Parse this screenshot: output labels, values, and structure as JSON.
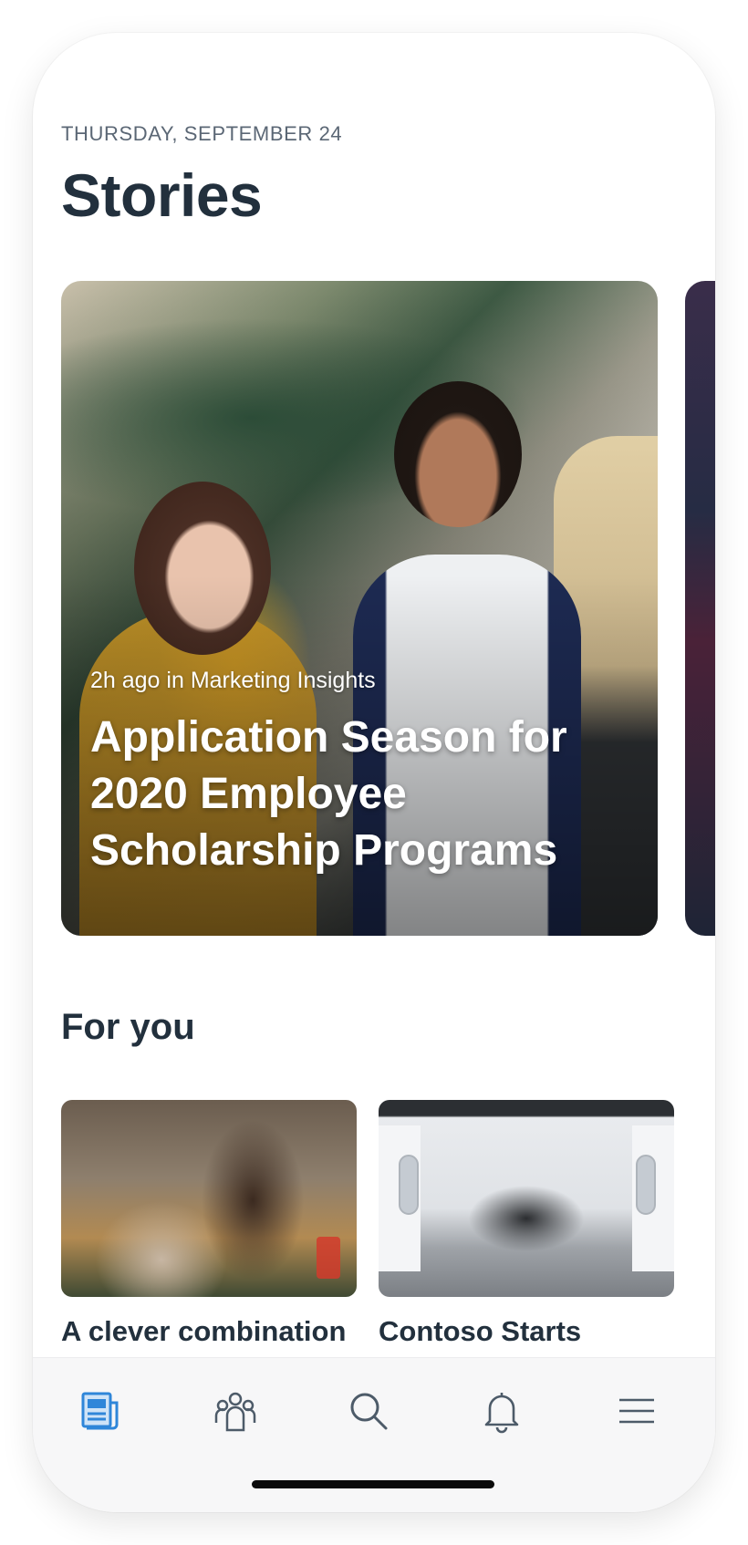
{
  "header": {
    "date": "THURSDAY, SEPTEMBER 24",
    "title": "Stories"
  },
  "hero_story": {
    "meta": "2h ago in Marketing Insights",
    "title": "Application Season for 2020 Employee Scholarship Programs"
  },
  "for_you": {
    "title": "For you",
    "cards": [
      {
        "title": "A clever combination of skills"
      },
      {
        "title": "Contoso Starts Production of the"
      }
    ]
  },
  "tab_bar": {
    "items": [
      {
        "icon": "news-icon",
        "active": true
      },
      {
        "icon": "people-icon",
        "active": false
      },
      {
        "icon": "search-icon",
        "active": false
      },
      {
        "icon": "bell-icon",
        "active": false
      },
      {
        "icon": "menu-icon",
        "active": false
      }
    ],
    "active_color": "#2f86d9",
    "inactive_color": "#4d5b69"
  }
}
